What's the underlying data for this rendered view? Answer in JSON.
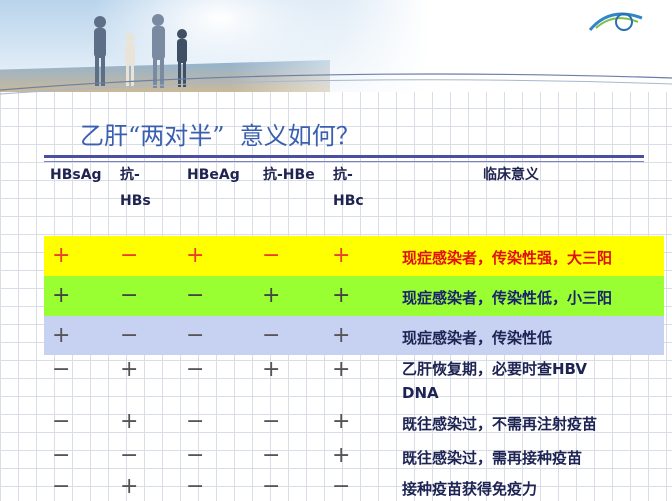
{
  "title": "乙肝“两对半”  意义如何？",
  "header": {
    "col1": "HBsAg",
    "col2_line1": "抗-",
    "col2_line2": "HBs",
    "col3": "HBeAg",
    "col4": "抗-HBe",
    "col5_line1": "抗-",
    "col5_line2": "HBc",
    "col6": "临床意义"
  },
  "rows": [
    {
      "cells": [
        "+",
        "−",
        "+",
        "−",
        "+"
      ],
      "meaning": "现症感染者，传染性强，大三阳",
      "bg": "#ffff00",
      "sign_color": "#e8402c",
      "text_color": "#e01010"
    },
    {
      "cells": [
        "+",
        "−",
        "−",
        "+",
        "+"
      ],
      "meaning": "现症感染者，传染性低，小三阳",
      "bg": "#99ff33",
      "sign_color": "#444444",
      "text_color": "#1a2270"
    },
    {
      "cells": [
        "+",
        "−",
        "−",
        "−",
        "+"
      ],
      "meaning": "现症感染者，传染性低",
      "bg": "#c7d2f2",
      "sign_color": "#555555",
      "text_color": "#1d2453"
    },
    {
      "cells": [
        "−",
        "+",
        "−",
        "+",
        "+"
      ],
      "meaning_line1": "乙肝恢复期，必要时查HBV",
      "meaning_line2": "DNA",
      "bg": "",
      "sign_color": "#555555",
      "text_color": "#1d2453"
    },
    {
      "cells": [
        "−",
        "+",
        "−",
        "−",
        "+"
      ],
      "meaning": "既往感染过，不需再注射疫苗",
      "bg": "",
      "sign_color": "#555555",
      "text_color": "#1d2453"
    },
    {
      "cells": [
        "−",
        "−",
        "−",
        "−",
        "+"
      ],
      "meaning": "既往感染过，需再接种疫苗",
      "bg": "",
      "sign_color": "#555555",
      "text_color": "#1d2453"
    },
    {
      "cells": [
        "−",
        "+",
        "−",
        "−",
        "−"
      ],
      "meaning": "接种疫苗获得免疫力",
      "bg": "",
      "sign_color": "#555555",
      "text_color": "#1d2453"
    }
  ]
}
